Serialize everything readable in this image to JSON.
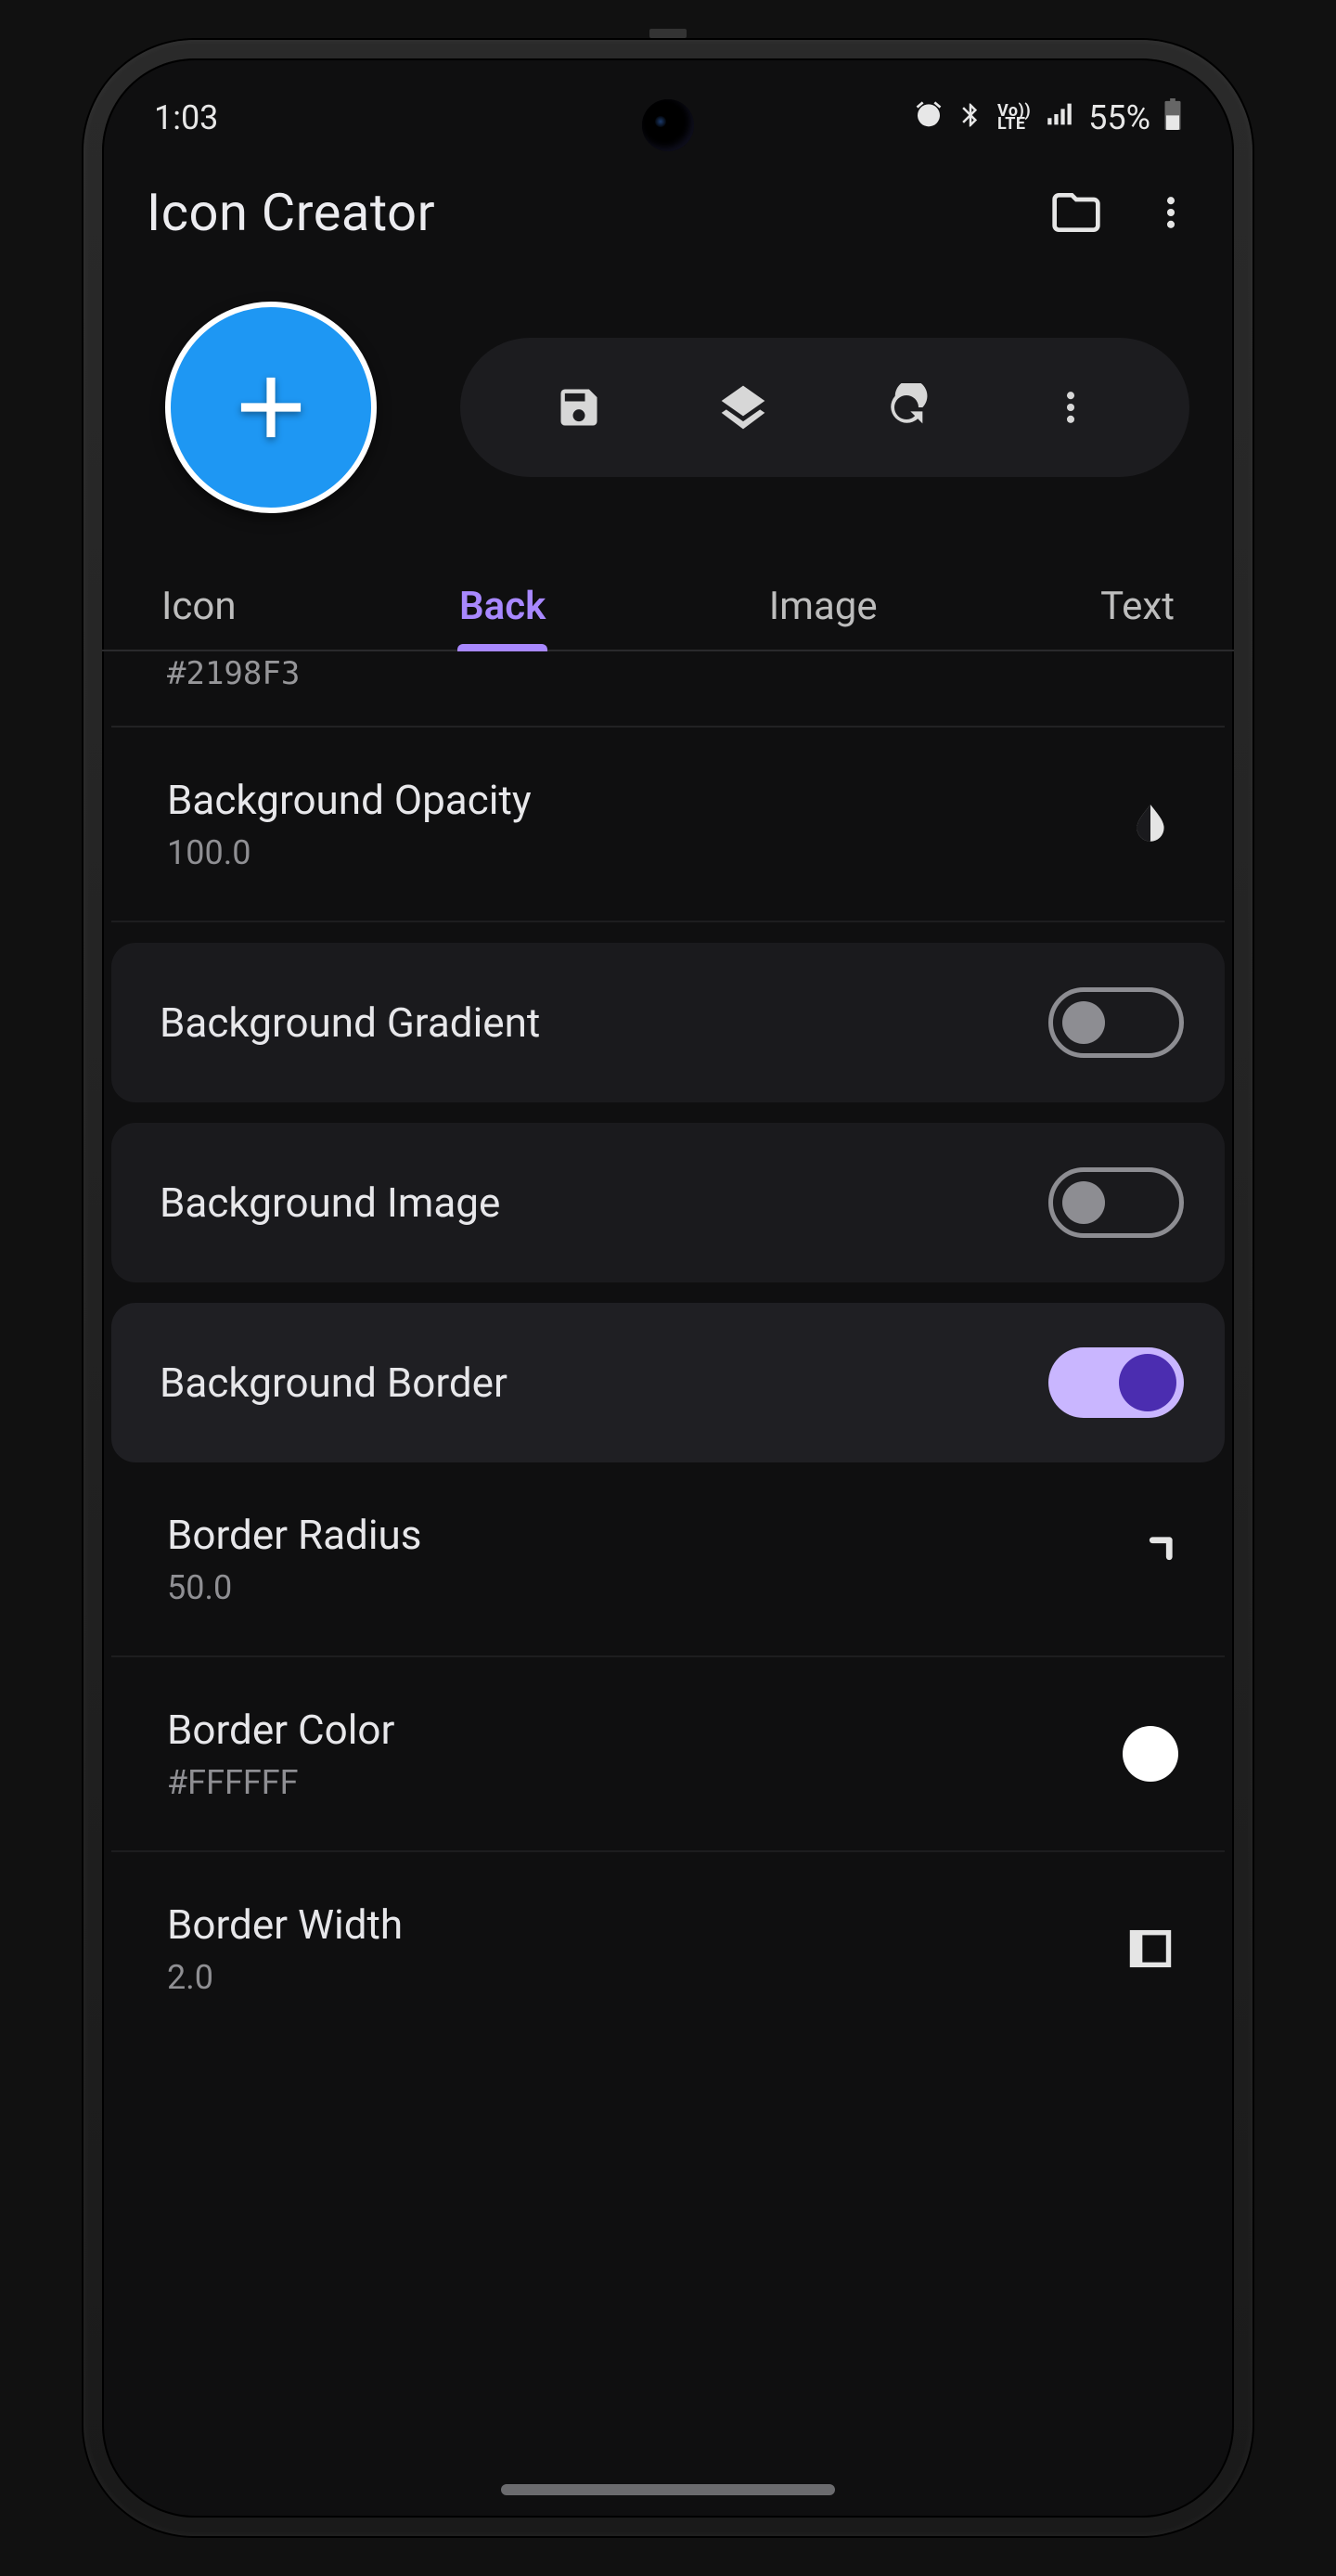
{
  "status": {
    "time": "1:03",
    "battery": "55%"
  },
  "app": {
    "title": "Icon Creator"
  },
  "tabs": {
    "icon": "Icon",
    "back": "Back",
    "image": "Image",
    "text": "Text"
  },
  "cutoff_value": "#2198F3",
  "list": {
    "bg_opacity": {
      "label": "Background Opacity",
      "value": "100.0"
    },
    "bg_gradient": {
      "label": "Background Gradient"
    },
    "bg_image": {
      "label": "Background Image"
    },
    "bg_border": {
      "label": "Background Border"
    },
    "border_radius": {
      "label": "Border Radius",
      "value": "50.0"
    },
    "border_color": {
      "label": "Border Color",
      "value": "#FFFFFF"
    },
    "border_width": {
      "label": "Border Width",
      "value": "2.0"
    }
  }
}
